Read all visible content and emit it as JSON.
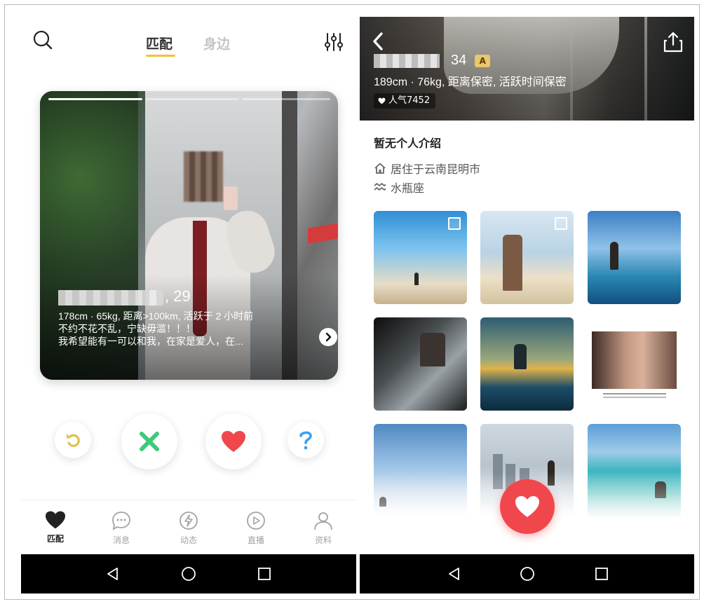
{
  "left": {
    "tabs": {
      "match": "匹配",
      "nearby": "身边"
    },
    "card": {
      "age": ", 29",
      "stats": "178cm · 65kg, 距离>100km, 活跃于 2 小时前",
      "bio_line1": "不约不花不乱，宁缺毋滥！！！",
      "bio_line2": "我希望能有一可以和我，在家是爱人，在..."
    },
    "bottom_nav": {
      "match": "匹配",
      "messages": "消息",
      "moments": "动态",
      "live": "直播",
      "profile": "资料"
    },
    "colors": {
      "accent": "#f3c137",
      "pass": "#3ec97a",
      "like": "#f0474c",
      "help": "#3aa0f0"
    }
  },
  "right": {
    "profile": {
      "age": "34",
      "badge": "A",
      "stats": "189cm · 76kg, 距离保密, 活跃时间保密",
      "popularity": "人气7452",
      "intro": "暂无个人介绍",
      "location": "居住于云南昆明市",
      "zodiac": "水瓶座"
    },
    "icons": [
      "back-icon",
      "share-icon",
      "home-icon",
      "aquarius-icon",
      "heart-icon"
    ]
  }
}
